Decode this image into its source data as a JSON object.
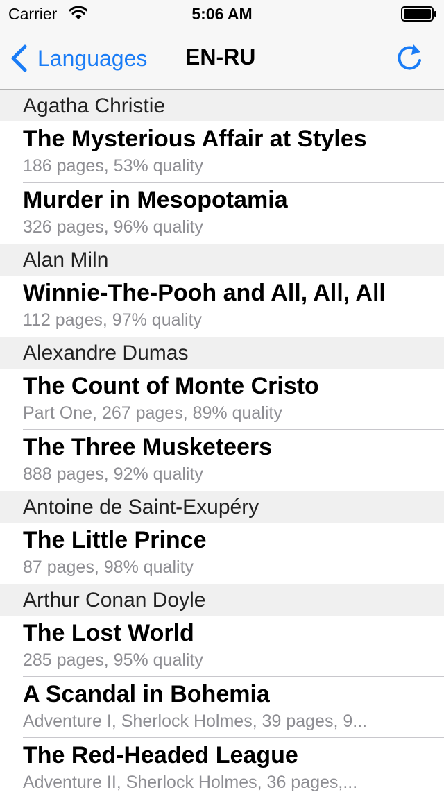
{
  "status_bar": {
    "carrier": "Carrier",
    "time": "5:06 AM",
    "wifi_icon": "wifi-icon",
    "battery_icon": "battery-full-icon"
  },
  "nav": {
    "back_label": "Languages",
    "back_icon": "chevron-left-icon",
    "title": "EN-RU",
    "refresh_icon": "refresh-icon",
    "tint_color": "#1a7cf6"
  },
  "sections": [
    {
      "header": "Agatha Christie",
      "rows": [
        {
          "title": "The Mysterious Affair at Styles",
          "subtitle": "186 pages, 53% quality"
        },
        {
          "title": "Murder in Mesopotamia",
          "subtitle": "326 pages, 96% quality"
        }
      ]
    },
    {
      "header": "Alan Miln",
      "rows": [
        {
          "title": "Winnie-The-Pooh and All, All, All",
          "subtitle": "112 pages, 97% quality"
        }
      ]
    },
    {
      "header": "Alexandre Dumas",
      "rows": [
        {
          "title": "The Count of Monte Cristo",
          "subtitle": "Part One, 267 pages, 89% quality"
        },
        {
          "title": "The Three Musketeers",
          "subtitle": "888 pages, 92% quality"
        }
      ]
    },
    {
      "header": "Antoine de Saint-Exupéry",
      "rows": [
        {
          "title": "The Little Prince",
          "subtitle": "87 pages, 98% quality"
        }
      ]
    },
    {
      "header": "Arthur Conan Doyle",
      "rows": [
        {
          "title": "The Lost World",
          "subtitle": "285 pages, 95% quality"
        },
        {
          "title": "A Scandal in Bohemia",
          "subtitle": "Adventure I, Sherlock Holmes, 39 pages, 9..."
        },
        {
          "title": "The Red-Headed League",
          "subtitle": "Adventure II, Sherlock Holmes, 36 pages,..."
        }
      ]
    }
  ]
}
